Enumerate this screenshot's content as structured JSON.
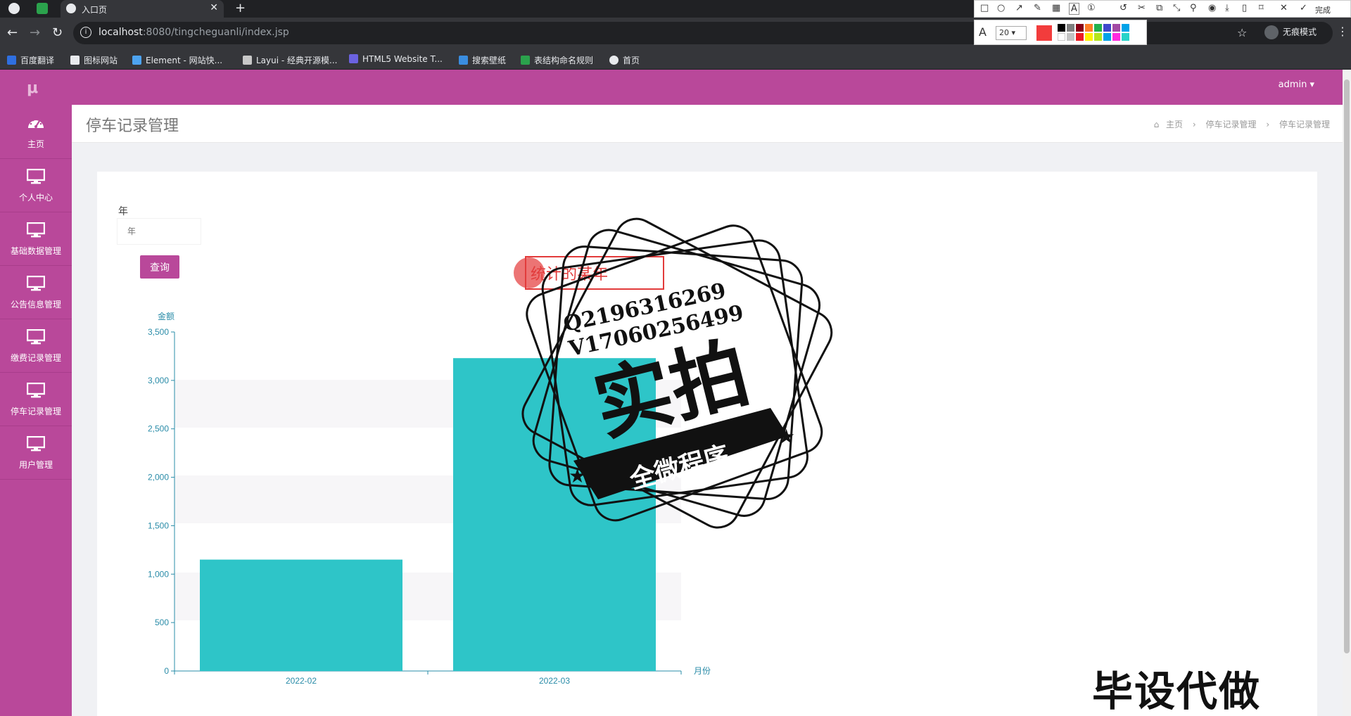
{
  "browser": {
    "tab_title": "入口页",
    "url_host": "localhost",
    "url_rest": ":8080/tingcheguanli/index.jsp",
    "profile_label": "无痕模式",
    "bookmarks": [
      "百度翻译",
      "图标网站",
      "Element - 网站快...",
      "Layui - 经典开源模...",
      "HTML5 Website T...",
      "搜索壁纸",
      "表结构命名规则",
      "首页"
    ],
    "screenshot_tool": {
      "done_label": "完成",
      "font_size": "20",
      "current_color": "#f23c3c"
    }
  },
  "app": {
    "user_menu": "admin ▾",
    "sidebar": [
      {
        "label": "主页",
        "icon": "dashboard-icon"
      },
      {
        "label": "个人中心",
        "icon": "monitor-icon"
      },
      {
        "label": "基础数据管理",
        "icon": "monitor-icon"
      },
      {
        "label": "公告信息管理",
        "icon": "monitor-icon"
      },
      {
        "label": "缴费记录管理",
        "icon": "monitor-icon"
      },
      {
        "label": "停车记录管理",
        "icon": "monitor-icon"
      },
      {
        "label": "用户管理",
        "icon": "monitor-icon"
      }
    ],
    "page_title": "停车记录管理",
    "breadcrumb": [
      "主页",
      "停车记录管理",
      "停车记录管理"
    ],
    "form": {
      "year_label": "年",
      "year_placeholder": "年",
      "query_button": "查询"
    },
    "colors": {
      "brand": "#b9489a",
      "bar": "#2ec5c8"
    }
  },
  "chart_data": {
    "type": "bar",
    "categories": [
      "2022-02",
      "2022-03"
    ],
    "values": [
      1150,
      3230
    ],
    "xlabel": "月份",
    "ylabel": "金额",
    "ylim": [
      0,
      3500
    ],
    "yticks": [
      0,
      500,
      1000,
      1500,
      2000,
      2500,
      3000,
      3500
    ],
    "ytick_labels": [
      "0",
      "500",
      "1,000",
      "1,500",
      "2,000",
      "2,500",
      "3,000",
      "3,500"
    ],
    "bar_color": "#2ec5c8",
    "grid": false
  },
  "overlay": {
    "annotation_text": "统计的某年",
    "stamp_contact_1": "Q2196316269",
    "stamp_contact_2": "V17060256499",
    "stamp_main": "实拍",
    "stamp_banner": "全微程序",
    "corner_watermark": "毕设代做"
  }
}
